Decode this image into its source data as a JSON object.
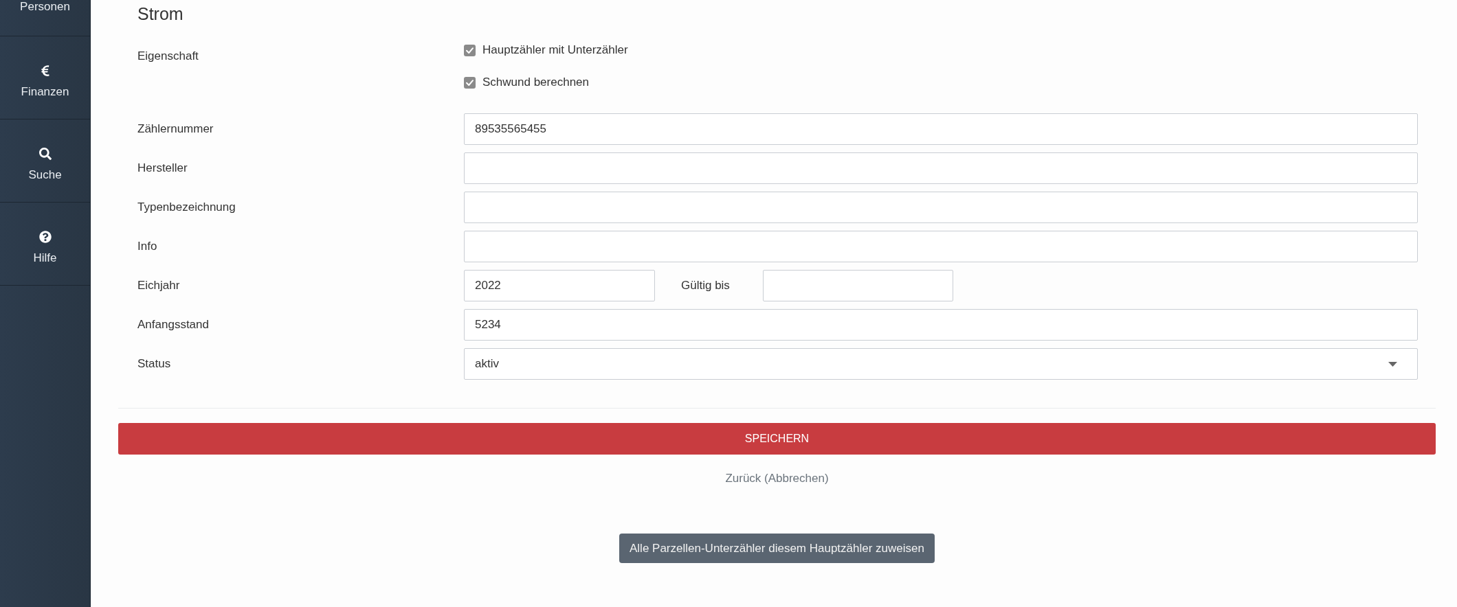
{
  "sidebar": {
    "items": [
      {
        "label": "Personen"
      },
      {
        "label": "Finanzen"
      },
      {
        "label": "Suche"
      },
      {
        "label": "Hilfe"
      }
    ]
  },
  "section_title": "Strom",
  "form": {
    "fields": [
      {
        "kind": "checkboxes",
        "label": "Eigenschaft",
        "options": [
          {
            "label": "Hauptzähler mit Unterzähler",
            "checked": true
          },
          {
            "label": "Schwund berechnen",
            "checked": true
          }
        ]
      },
      {
        "kind": "text",
        "label": "Zählernummer",
        "value": "89535565455"
      },
      {
        "kind": "text",
        "label": "Hersteller"
      },
      {
        "kind": "text",
        "label": "Typenbezeichnung"
      },
      {
        "kind": "text",
        "label": "Info"
      },
      {
        "kind": "pair",
        "label": "Eichjahr",
        "value": "2022",
        "second_label": "Gültig bis"
      },
      {
        "kind": "text",
        "label": "Anfangsstand",
        "value": "5234"
      },
      {
        "kind": "select",
        "label": "Status",
        "value": "aktiv"
      }
    ]
  },
  "buttons": [
    {
      "kind": "primary",
      "label": "SPEICHERN"
    },
    {
      "kind": "link",
      "label": "Zurück (Abbrechen)"
    },
    {
      "kind": "secondary",
      "label": "Alle Parzellen-Unterzähler diesem Hauptzähler zuweisen"
    }
  ]
}
